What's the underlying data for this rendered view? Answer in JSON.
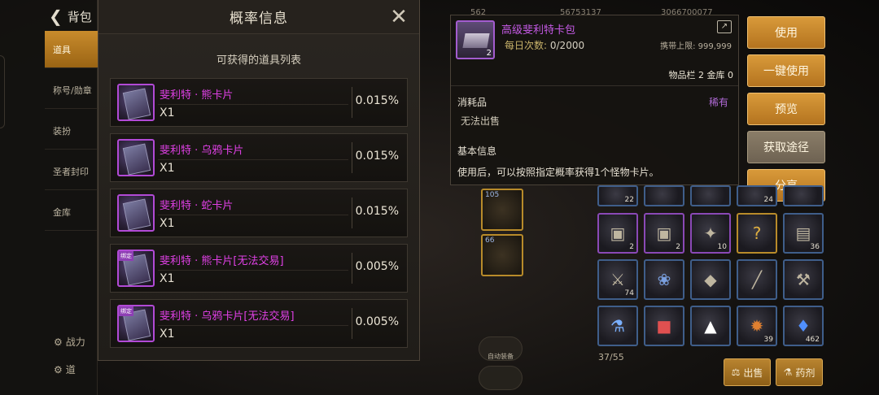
{
  "nav": {
    "back_label": "背包",
    "items": [
      "道具",
      "称号/勋章",
      "装扮",
      "圣者封印",
      "金库"
    ],
    "bottom_items": [
      "战力",
      "道"
    ]
  },
  "top_stats": [
    "562",
    "56753137",
    "3066700077"
  ],
  "dialog": {
    "title": "概率信息",
    "close_icon": "close-icon",
    "subtitle": "可获得的道具列表",
    "rows": [
      {
        "name": "斐利特 · 熊卡片",
        "qty": "X1",
        "pct": "0.015%",
        "badge": ""
      },
      {
        "name": "斐利特 · 乌鸦卡片",
        "qty": "X1",
        "pct": "0.015%",
        "badge": ""
      },
      {
        "name": "斐利特 · 蛇卡片",
        "qty": "X1",
        "pct": "0.015%",
        "badge": ""
      },
      {
        "name": "斐利特 · 熊卡片[无法交易]",
        "qty": "X1",
        "pct": "0.005%",
        "badge": "绑定"
      },
      {
        "name": "斐利特 · 乌鸦卡片[无法交易]",
        "qty": "X1",
        "pct": "0.005%",
        "badge": "绑定"
      }
    ]
  },
  "detail": {
    "name": "高级斐利特卡包",
    "count": "2",
    "daily_label": "每日次数:",
    "daily_value": "0/2000",
    "carry_limit": "携带上限: 999,999",
    "inventory": "物品栏 2 金库 0",
    "type": "消耗品",
    "rarity": "稀有",
    "no_sell": "无法出售",
    "basic_title": "基本信息",
    "description": "使用后，可以按照指定概率获得1个怪物卡片。"
  },
  "actions": {
    "use": "使用",
    "use_all": "一键使用",
    "preview": "预览",
    "obtain": "获取途径",
    "share": "分享"
  },
  "inventory": {
    "count": "37/55",
    "slot_numbers": [
      "22",
      "",
      "",
      "24",
      "",
      "2",
      "2",
      "10",
      "",
      "36",
      "74",
      "",
      "",
      "",
      "",
      "",
      "",
      "",
      "39",
      "462"
    ],
    "sell_label": "出售",
    "craft_label": "药剂"
  },
  "mid_column": {
    "slot_labels": [
      "105",
      "66"
    ],
    "round_labels": [
      "自动装备",
      ""
    ]
  },
  "colors": {
    "accent": "#c88b2c",
    "item_name": "#e040e6",
    "rare_purple": "#b06ad6"
  }
}
